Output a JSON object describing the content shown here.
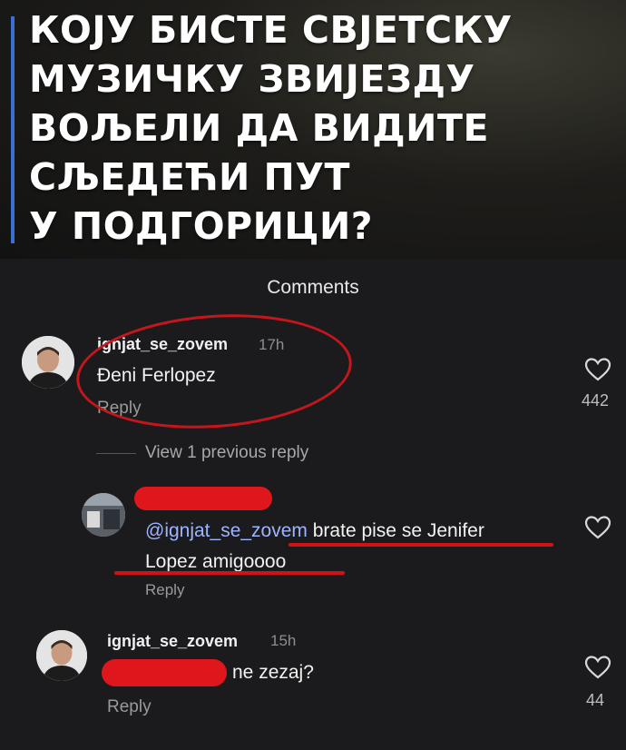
{
  "banner": {
    "title_lines": [
      "КОЈУ БИСТЕ СВЈЕТСКУ",
      "МУЗИЧКУ ЗВИЈЕЗДУ",
      "ВОЉЕЛИ ДА ВИДИТЕ",
      "СЉЕДЕЋИ ПУТ",
      "У ПОДГОРИЦИ?"
    ],
    "accent_color": "#3b6fd1"
  },
  "sheet": {
    "title": "Comments"
  },
  "comments": [
    {
      "username": "ignjat_se_zovem",
      "time": "17h",
      "text": "Đeni Ferlopez",
      "reply_label": "Reply",
      "likes": "442",
      "icon": "heart-icon"
    },
    {
      "view_replies_label": "View 1 previous reply"
    },
    {
      "mention": "@ignjat_se_zovem",
      "text_line1": " brate pise se Jenifer",
      "text_line2": "Lopez amigoooo",
      "reply_label": "Reply",
      "icon": "heart-icon"
    },
    {
      "username": "ignjat_se_zovem",
      "time": "15h",
      "text": "ne zezaj?",
      "reply_label": "Reply",
      "likes": "44",
      "icon": "heart-icon"
    }
  ],
  "annotation_color": "#d21219"
}
